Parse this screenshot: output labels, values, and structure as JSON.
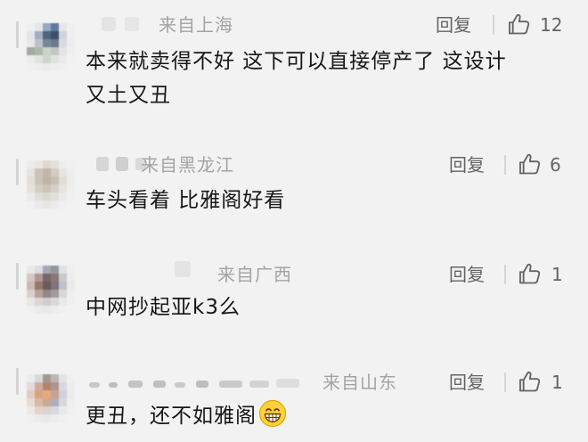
{
  "comments": [
    {
      "location": "来自上海",
      "reply_label": "回复",
      "like_count": "12",
      "text_lines": [
        "本来就卖得不好 这下可以直接停产了 这设计",
        "又土又丑"
      ]
    },
    {
      "location": "来自黑龙江",
      "reply_label": "回复",
      "like_count": "6",
      "text_lines": [
        "车头看着 比雅阁好看"
      ]
    },
    {
      "location": "来自广西",
      "reply_label": "回复",
      "like_count": "1",
      "text_lines": [
        "中网抄起亚k3么"
      ]
    },
    {
      "location": "来自山东",
      "reply_label": "回复",
      "like_count": "1",
      "text_lines": [
        "更丑，还不如雅阁"
      ],
      "emoji": "grinning-face-emoji"
    }
  ],
  "icons": {
    "like": "thumbs-up-icon"
  },
  "colors": {
    "background": "#f2f2f2",
    "text": "#161616",
    "meta": "#a3a3a3",
    "action": "#646464"
  }
}
